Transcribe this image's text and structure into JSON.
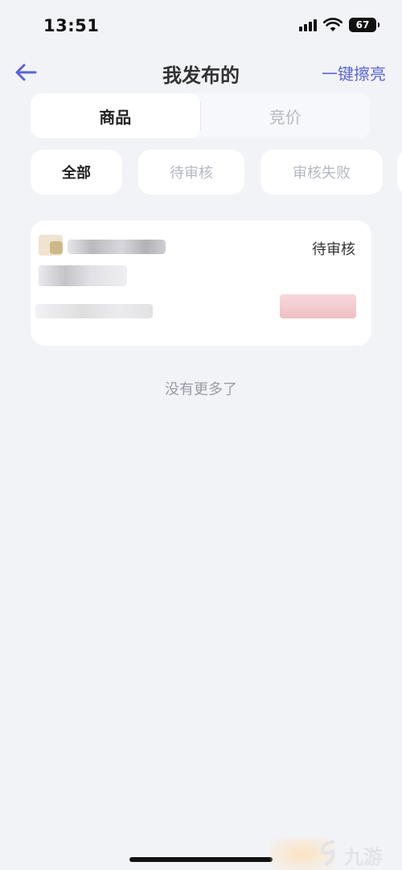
{
  "status_bar": {
    "time": "13:51",
    "battery": "67",
    "icons": [
      "signal-icon",
      "wifi-icon",
      "battery-icon"
    ]
  },
  "nav": {
    "back_icon": "arrow-left-icon",
    "title": "我发布的",
    "action_label": "一键擦亮",
    "accent_color": "#5865d6"
  },
  "tabs": [
    {
      "label": "商品",
      "active": true
    },
    {
      "label": "竞价",
      "active": false
    }
  ],
  "filters": [
    {
      "label": "全部",
      "active": true
    },
    {
      "label": "待审核",
      "active": false
    },
    {
      "label": "审核失败",
      "active": false
    }
  ],
  "items": [
    {
      "status": "待审核"
    }
  ],
  "list_footer": "没有更多了",
  "watermark": {
    "text": "九游"
  }
}
